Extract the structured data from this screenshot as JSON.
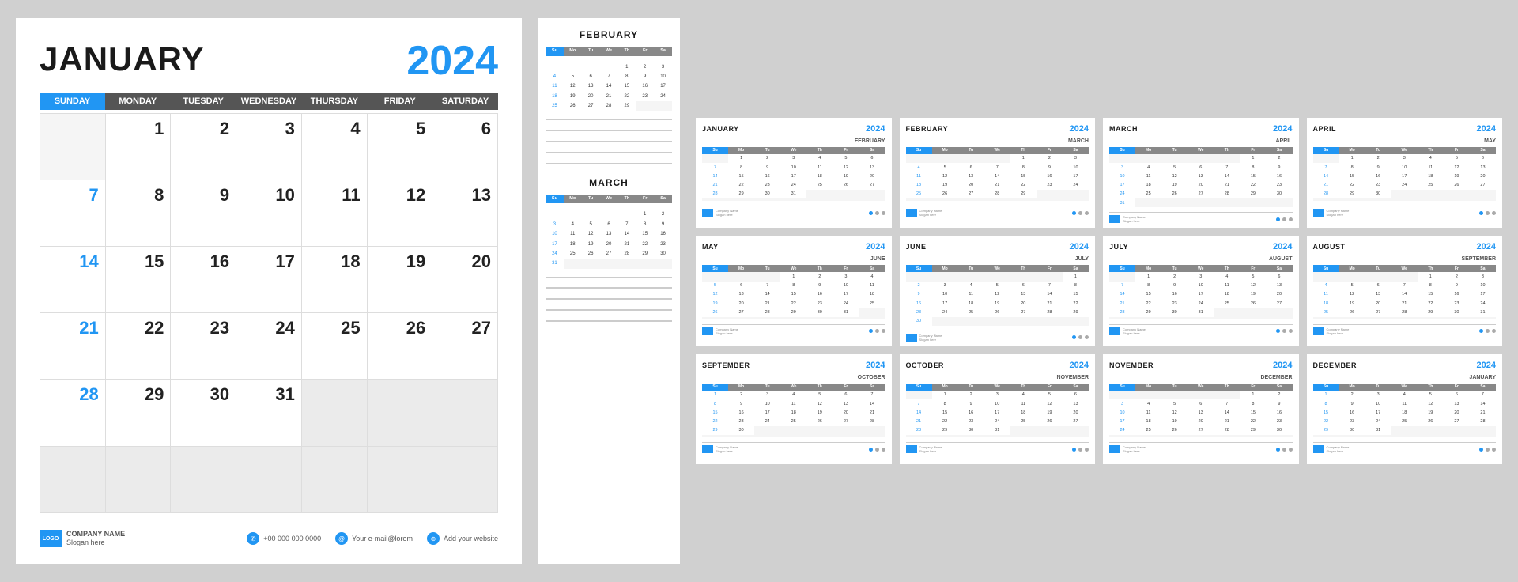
{
  "main": {
    "month": "JANUARY",
    "year": "2024",
    "days": [
      "Sunday",
      "Monday",
      "Tuesday",
      "Wednesday",
      "Thursday",
      "Friday",
      "Saturday"
    ],
    "weeks": [
      [
        "",
        "1",
        "2",
        "3",
        "4",
        "5",
        "6"
      ],
      [
        "7",
        "8",
        "9",
        "10",
        "11",
        "12",
        "13"
      ],
      [
        "14",
        "15",
        "16",
        "17",
        "18",
        "19",
        "20"
      ],
      [
        "21",
        "22",
        "23",
        "24",
        "25",
        "26",
        "27"
      ],
      [
        "28",
        "29",
        "30",
        "31",
        "",
        "",
        ""
      ],
      [
        "",
        "",
        "",
        "",
        "",
        "",
        ""
      ]
    ],
    "footer": {
      "logo": "LOGO",
      "company": "COMPANY NAME",
      "slogan": "Slogan here",
      "phone": "+00 000 000 0000",
      "email": "Your e-mail@lorem",
      "website": "Add your website"
    }
  },
  "side": {
    "february": "FEBRUARY",
    "march": "MARCH"
  },
  "months": [
    {
      "name": "JANUARY",
      "year": "2024",
      "next": "FEBRUARY"
    },
    {
      "name": "FEBRUARY",
      "year": "2024",
      "next": "MARCH"
    },
    {
      "name": "MARCH",
      "year": "2024",
      "next": "APRIL"
    },
    {
      "name": "APRIL",
      "year": "2024",
      "next": "MAY"
    },
    {
      "name": "MAY",
      "year": "2024",
      "next": "JUNE"
    },
    {
      "name": "JUNE",
      "year": "2024",
      "next": "JULY"
    },
    {
      "name": "JULY",
      "year": "2024",
      "next": "AUGUST"
    },
    {
      "name": "AUGUST",
      "year": "2024",
      "next": "SEPTEMBER"
    },
    {
      "name": "SEPTEMBER",
      "year": "2024",
      "next": "OCTOBER"
    },
    {
      "name": "OCTOBER",
      "year": "2024",
      "next": "NOVEMBER"
    },
    {
      "name": "NOVEMBER",
      "year": "2024",
      "next": "DECEMBER"
    },
    {
      "name": "DECEMBER",
      "year": "2024",
      "next": "JANUARY"
    }
  ]
}
